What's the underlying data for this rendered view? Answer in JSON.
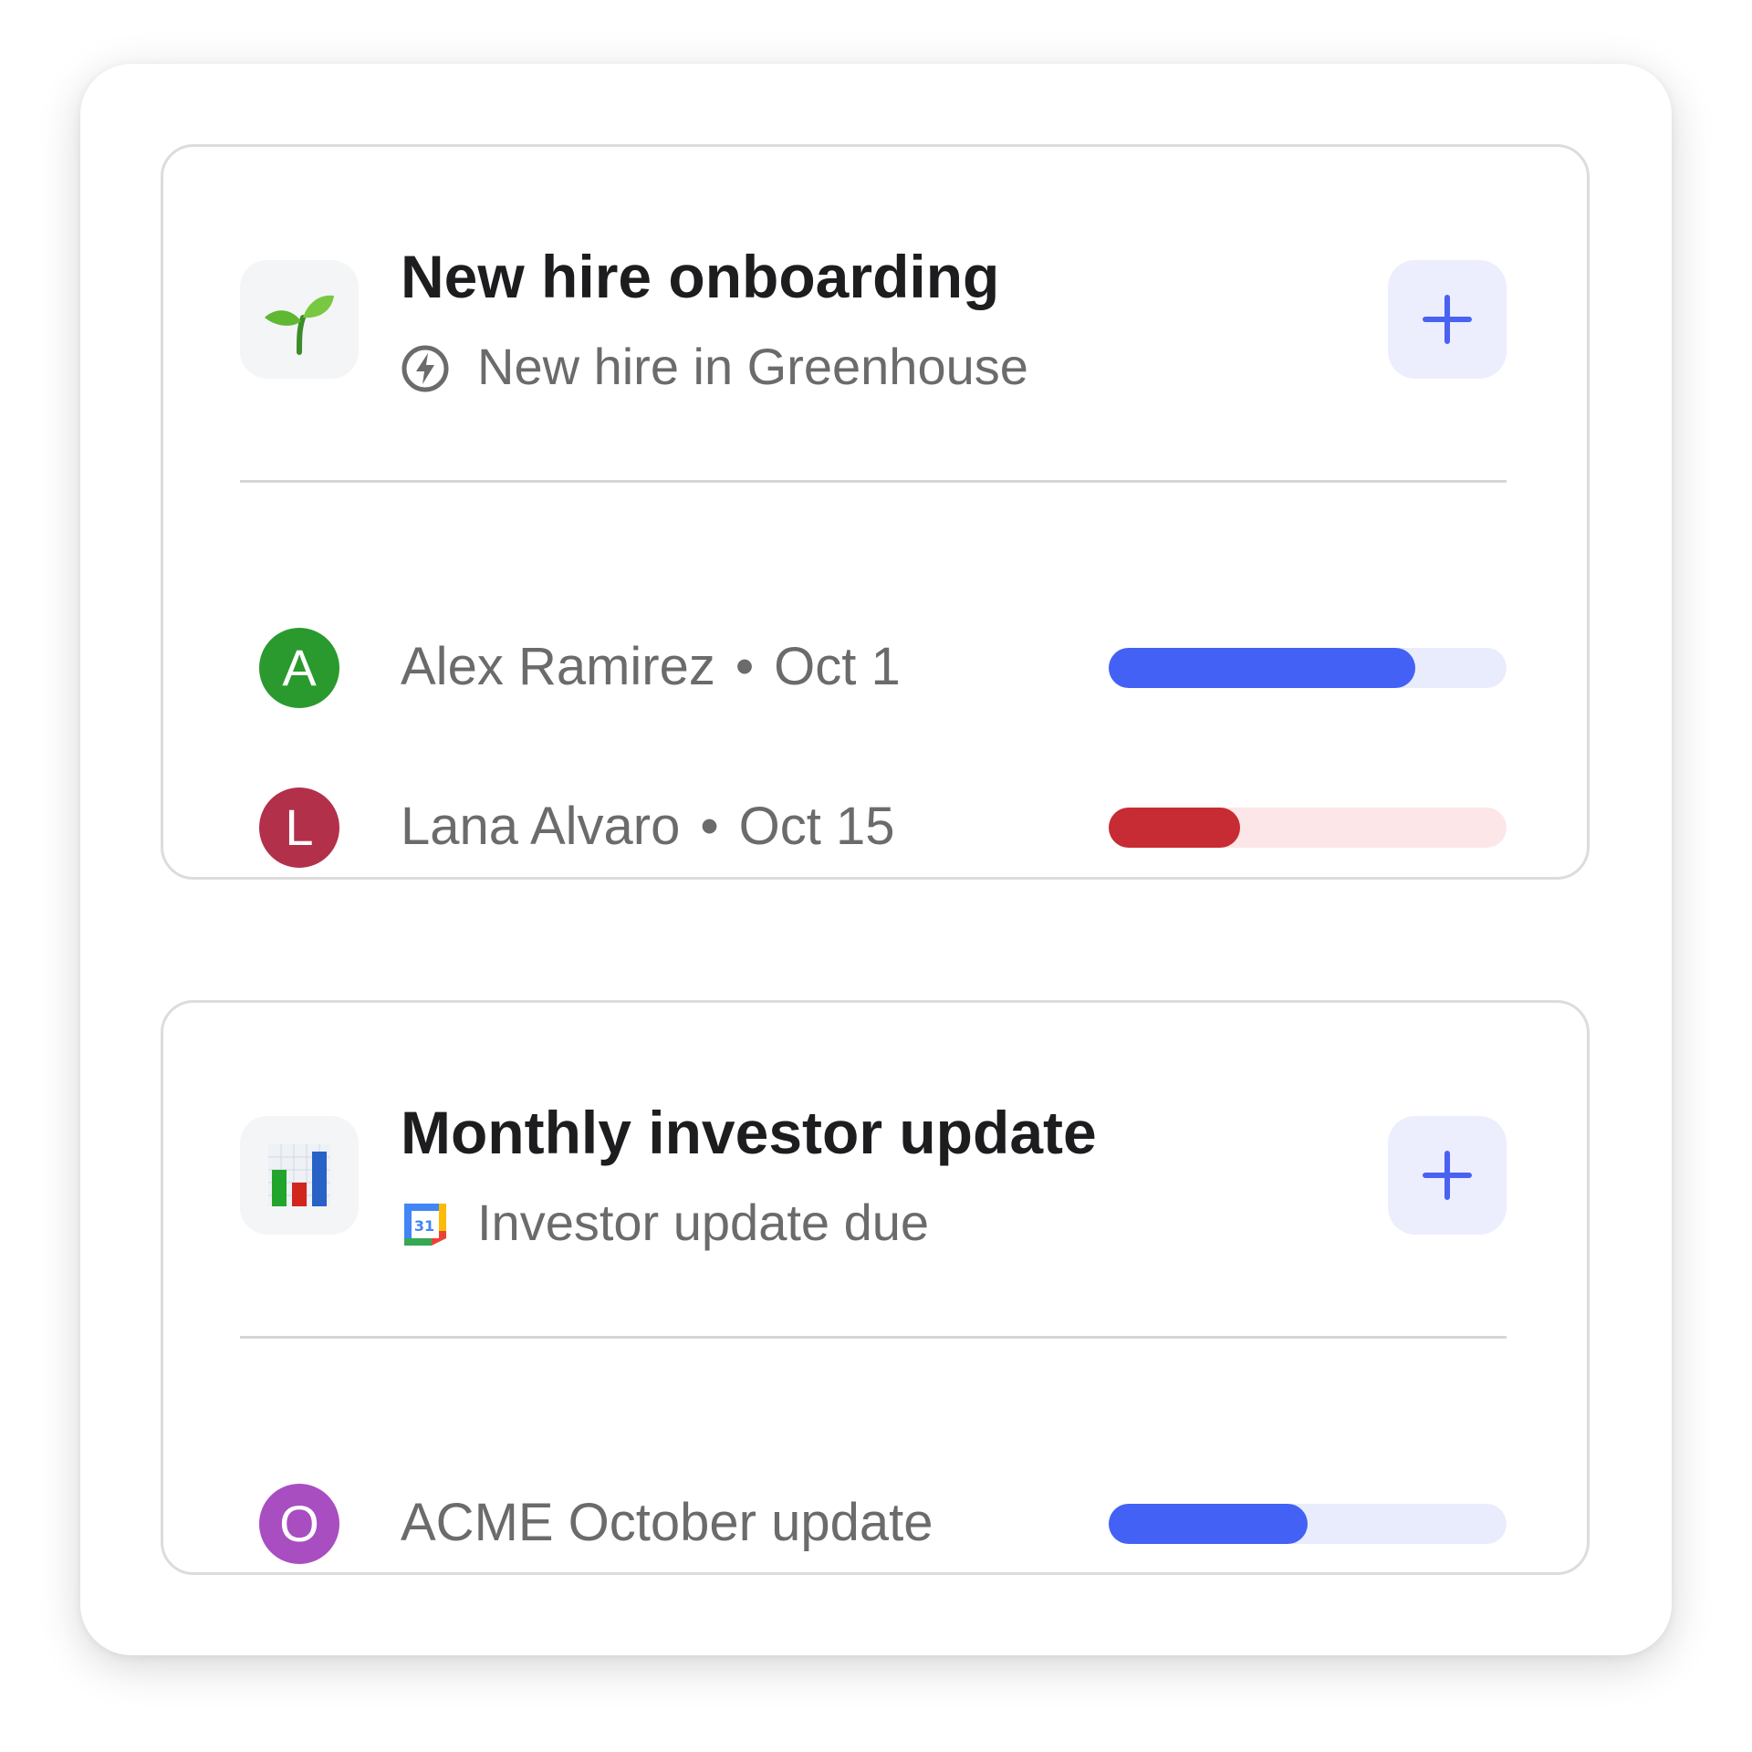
{
  "colors": {
    "accent_blue": "#4361f5",
    "track_blue": "#e9ecfd",
    "accent_red": "#c72b33",
    "track_red": "#fce6e7",
    "plus_icon": "#4a62f1",
    "plus_bg": "#eceefe"
  },
  "workflows": [
    {
      "title": "New hire onboarding",
      "emoji_icon": "seedling-icon",
      "trigger_icon": "lightning-bolt-circle-icon",
      "trigger": "New hire in Greenhouse",
      "items": [
        {
          "initial": "A",
          "avatar_color": "#2a9a2e",
          "name": "Alex Ramirez",
          "separator": "•",
          "date": "Oct 1",
          "progress": 0.77,
          "bar_color": "#4361f5",
          "track_color": "#e9ecfd"
        },
        {
          "initial": "L",
          "avatar_color": "#b3304a",
          "name": "Lana Alvaro",
          "separator": "•",
          "date": "Oct 15",
          "progress": 0.33,
          "bar_color": "#c72b33",
          "track_color": "#fce6e7"
        }
      ]
    },
    {
      "title": "Monthly investor update",
      "emoji_icon": "bar-chart-icon",
      "trigger_icon": "google-calendar-icon",
      "trigger": "Investor update due",
      "items": [
        {
          "initial": "O",
          "avatar_color": "#a84ec1",
          "name": "ACME October update",
          "progress": 0.5,
          "bar_color": "#4361f5",
          "track_color": "#e9ecfd"
        }
      ]
    }
  ]
}
